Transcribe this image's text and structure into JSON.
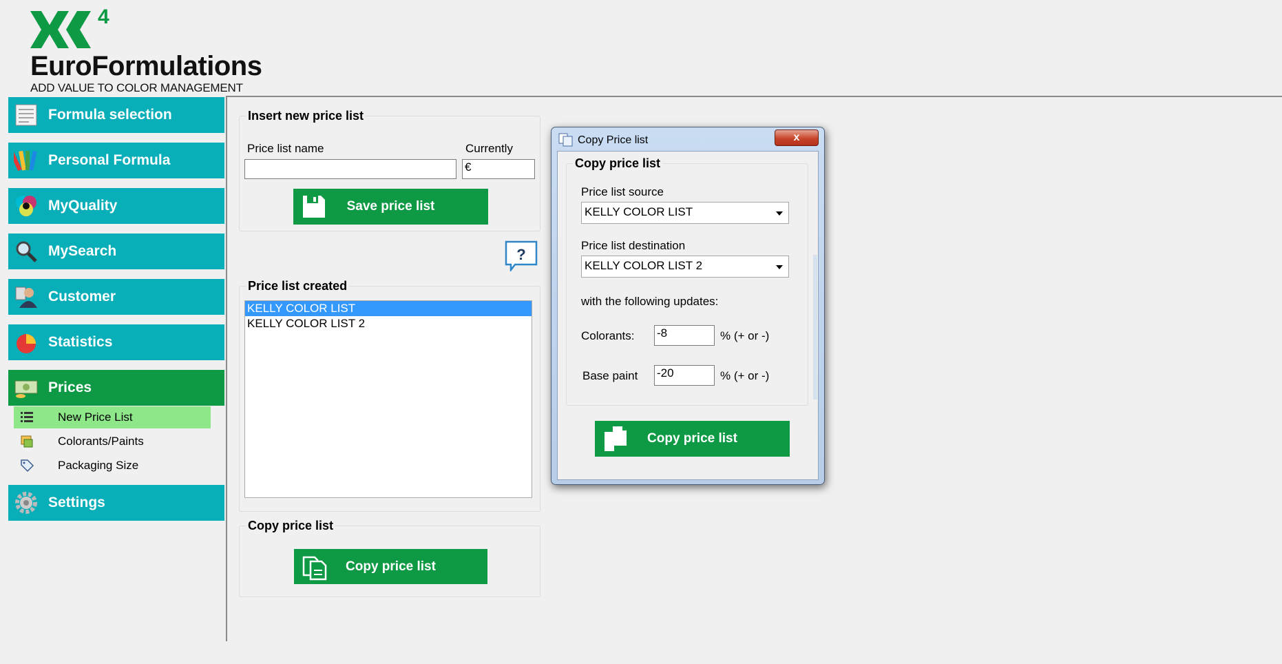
{
  "brand": {
    "logo_superscript": "4",
    "name": "EuroFormulations",
    "tagline": "ADD VALUE TO COLOR MANAGEMENT",
    "color": "#0e9a45"
  },
  "sidebar": {
    "items": [
      {
        "label": "Formula selection",
        "icon": "formula-list-icon"
      },
      {
        "label": "Personal Formula",
        "icon": "color-fan-icon"
      },
      {
        "label": "MyQuality",
        "icon": "color-circles-icon"
      },
      {
        "label": "MySearch",
        "icon": "magnifier-icon"
      },
      {
        "label": "Customer",
        "icon": "person-icon"
      },
      {
        "label": "Statistics",
        "icon": "pie-chart-icon"
      },
      {
        "label": "Prices",
        "icon": "money-icon"
      },
      {
        "label": "Settings",
        "icon": "gear-icon"
      }
    ],
    "sub_items": [
      {
        "label": "New Price List",
        "icon": "list-icon"
      },
      {
        "label": "Colorants/Paints",
        "icon": "paint-icon"
      },
      {
        "label": "Packaging Size",
        "icon": "tag-icon"
      }
    ],
    "colors": {
      "item": "#08aeb8",
      "active": "#0e9a45",
      "sub_active": "#8ee88a"
    }
  },
  "insert_group": {
    "title": "Insert new price list",
    "name_label": "Price list name",
    "name_value": "",
    "currency_label": "Currently",
    "currency_value": "€",
    "save_label": "Save price list"
  },
  "help_label": "?",
  "created_group": {
    "title": "Price list created",
    "items": [
      "KELLY COLOR LIST",
      "KELLY COLOR LIST 2"
    ],
    "selected_index": 0
  },
  "copy_group": {
    "title": "Copy price list",
    "button_label": "Copy price list"
  },
  "dialog": {
    "title": "Copy Price list",
    "close_label": "x",
    "group_title": "Copy price list",
    "source_label": "Price list source",
    "source_value": "KELLY COLOR LIST",
    "destination_label": "Price list destination",
    "destination_value": "KELLY COLOR LIST 2",
    "updates_label": "with the following updates:",
    "colorants_label": "Colorants:",
    "colorants_value": "-8",
    "base_label": "Base paint",
    "base_value": "-20",
    "percent_label": "% (+ or -)",
    "button_label": "Copy price list"
  }
}
